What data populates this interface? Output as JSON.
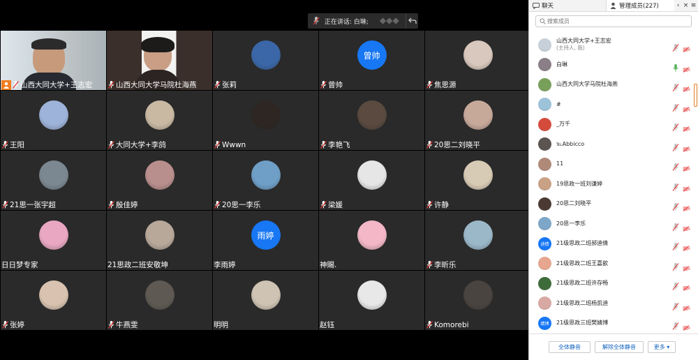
{
  "speaker_bar": {
    "text": "正在讲话: 白琳;"
  },
  "tiles": [
    {
      "name": "山西大同大学+王志宏",
      "kind": "cam1",
      "host": true
    },
    {
      "name": "山西大同大学马院杜海燕",
      "kind": "cam2"
    },
    {
      "name": "张莉",
      "kind": "img",
      "color": "#3b67a8"
    },
    {
      "name": "曾帅",
      "kind": "text",
      "avatar_text": "曾帅"
    },
    {
      "name": "焦思源",
      "kind": "img",
      "color": "#d9c8bd"
    },
    {
      "name": "王阳",
      "kind": "img",
      "color": "#9db3d9"
    },
    {
      "name": "大同大学+李鸽",
      "kind": "img",
      "color": "#c9b9a3"
    },
    {
      "name": "Wwwn",
      "kind": "img",
      "color": "#2d2623"
    },
    {
      "name": "李艳飞",
      "kind": "img",
      "color": "#5a4a3f"
    },
    {
      "name": "20思二刘晓平",
      "kind": "img",
      "color": "#c7a99a"
    },
    {
      "name": "21思一张宇超",
      "kind": "img",
      "color": "#7b8891"
    },
    {
      "name": "殷佳婷",
      "kind": "img",
      "color": "#b98f8d"
    },
    {
      "name": "20思一李乐",
      "kind": "img",
      "color": "#6f9fc7"
    },
    {
      "name": "梁媛",
      "kind": "img",
      "color": "#e6e6e6"
    },
    {
      "name": "许静",
      "kind": "img",
      "color": "#d8cbb5"
    },
    {
      "name": "日日梦专家",
      "kind": "img",
      "color": "#e9a7c2",
      "no_mic": true
    },
    {
      "name": "21思政二班安敬坤",
      "kind": "img",
      "color": "#b8a89a",
      "no_mic": true
    },
    {
      "name": "李雨婷",
      "kind": "text",
      "avatar_text": "雨婷",
      "no_mic": true
    },
    {
      "name": "神賜.",
      "kind": "img",
      "color": "#f3b7c7",
      "no_mic": true
    },
    {
      "name": "李昕乐",
      "kind": "img",
      "color": "#9bb8c9"
    },
    {
      "name": "张婷",
      "kind": "img",
      "color": "#d9c3b0"
    },
    {
      "name": "牛燕雯",
      "kind": "img",
      "color": "#5f5953"
    },
    {
      "name": "明明",
      "kind": "img",
      "color": "#cfc3b3",
      "no_mic": true
    },
    {
      "name": "赵钰",
      "kind": "img",
      "color": "#e8e8e8",
      "no_mic": true
    },
    {
      "name": "Komorebi",
      "kind": "img",
      "color": "#4a4440"
    }
  ],
  "panel": {
    "tab_chat": "聊天",
    "tab_members": "管理成员(227)",
    "tab_controls": [
      "‹",
      "×",
      "≡"
    ],
    "search_placeholder": "搜索成员",
    "members": [
      {
        "name": "山西大同大学+王志宏",
        "sub": "(主持人, 我)",
        "color": "#c7d0d8",
        "mic": "muted"
      },
      {
        "name": "白琳",
        "color": "#8a7f86",
        "mic": "active"
      },
      {
        "name": "山西大同大学马院杜海燕",
        "color": "#78a05a",
        "mic": "muted"
      },
      {
        "name": "#",
        "color": "#9cc3d9",
        "mic": "muted"
      },
      {
        "name": "_万千",
        "color": "#d44b3c",
        "mic": "muted"
      },
      {
        "name": "℡Abbicco",
        "color": "#5b5450",
        "mic": "muted"
      },
      {
        "name": "11",
        "color": "#b08a78",
        "mic": "muted"
      },
      {
        "name": "19思政一班刘谦婷",
        "color": "#c9a184",
        "mic": "muted"
      },
      {
        "name": "20思二刘晓平",
        "color": "#4b3a33",
        "mic": "muted"
      },
      {
        "name": "20思一李乐",
        "color": "#7da6c9",
        "mic": "muted"
      },
      {
        "name": "21级思政二班郝迪倩",
        "avatar_text": "迪倩",
        "mic": "muted"
      },
      {
        "name": "21级思政二班王嘉歆",
        "color": "#e7a68f",
        "mic": "muted"
      },
      {
        "name": "21级思政二班许存畅",
        "color": "#3e6b3a",
        "mic": "muted"
      },
      {
        "name": "21级思政二班杨凯迪",
        "color": "#d7a9a2",
        "mic": "muted"
      },
      {
        "name": "21级思政三班樊婧博",
        "avatar_text": "婧博",
        "mic": "muted"
      }
    ],
    "footer": {
      "mute_all": "全体静音",
      "unmute_all": "解除全体静音",
      "more": "更多 ▾"
    }
  }
}
